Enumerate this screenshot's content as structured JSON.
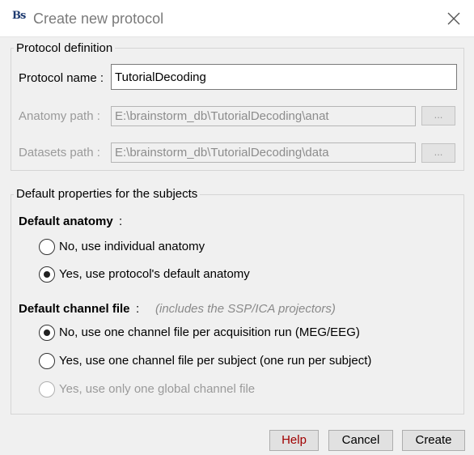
{
  "window": {
    "app_icon": "Bs",
    "title": "Create new protocol",
    "close_icon": "close-icon"
  },
  "protocol_definition": {
    "title": "Protocol definition",
    "name_label": "Protocol name :",
    "name_value": "TutorialDecoding",
    "anatomy_label": "Anatomy path :",
    "anatomy_value": "E:\\brainstorm_db\\TutorialDecoding\\anat",
    "anatomy_browse": "...",
    "datasets_label": "Datasets path :",
    "datasets_value": "E:\\brainstorm_db\\TutorialDecoding\\data",
    "datasets_browse": "..."
  },
  "subject_defaults": {
    "title": "Default properties for the subjects",
    "anatomy_heading": "Default anatomy",
    "anatomy_colon": ":",
    "anatomy_options": [
      {
        "label": "No, use individual anatomy",
        "checked": false,
        "enabled": true
      },
      {
        "label": "Yes, use protocol's default anatomy",
        "checked": true,
        "enabled": true
      }
    ],
    "channel_heading": "Default channel file",
    "channel_colon": ":",
    "channel_hint": "(includes the SSP/ICA projectors)",
    "channel_options": [
      {
        "label": "No, use one channel file per acquisition run (MEG/EEG)",
        "checked": true,
        "enabled": true
      },
      {
        "label": "Yes, use one channel file per subject  (one run per subject)",
        "checked": false,
        "enabled": true
      },
      {
        "label": "Yes, use only one global channel file",
        "checked": false,
        "enabled": false
      }
    ]
  },
  "buttons": {
    "help": "Help",
    "cancel": "Cancel",
    "create": "Create"
  },
  "colors": {
    "help_text": "#a00000",
    "disabled_text": "#9a9a9a"
  }
}
